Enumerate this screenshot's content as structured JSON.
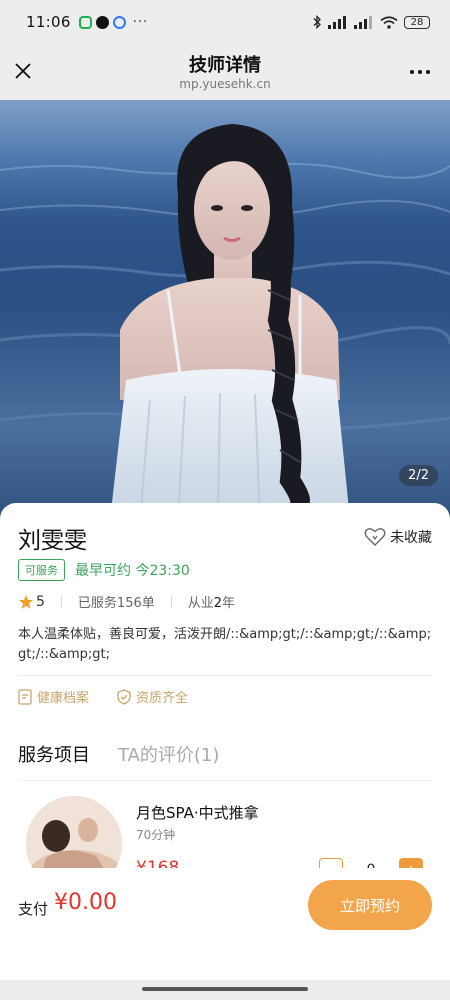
{
  "status_bar": {
    "time": "11:06",
    "battery": "28",
    "more": "···"
  },
  "nav": {
    "title": "技师详情",
    "url": "mp.yuesehk.cn"
  },
  "hero": {
    "pager": "2/2"
  },
  "therapist": {
    "name": "刘雯雯",
    "favorite_label": "未收藏",
    "status_badge": "可服务",
    "earliest_label": "最早可约",
    "earliest_time": "今23:30",
    "rating": "5",
    "served": "已服务156单",
    "experience_prefix": "从业",
    "experience_years": "2",
    "experience_suffix": "年",
    "bio": "本人温柔体贴，善良可爱，活泼开朗/::&amp;gt;/::&amp;gt;/::&amp;gt;/::&amp;gt;",
    "tags": [
      "健康档案",
      "资质齐全"
    ]
  },
  "tabs": [
    {
      "label": "服务项目"
    },
    {
      "label": "TA的评价(1)"
    }
  ],
  "service": {
    "name": "月色SPA·中式推拿",
    "duration": "70分钟",
    "price": "¥168",
    "quantity": "0",
    "minus": "−",
    "plus": "+"
  },
  "footer": {
    "pay_label": "支付",
    "amount": "¥0.00",
    "book_label": "立即预约"
  },
  "colors": {
    "accent": "#f2a54b",
    "price": "#e5322d",
    "status_green": "#3aa55a",
    "tag_gold": "#c9a56c"
  }
}
